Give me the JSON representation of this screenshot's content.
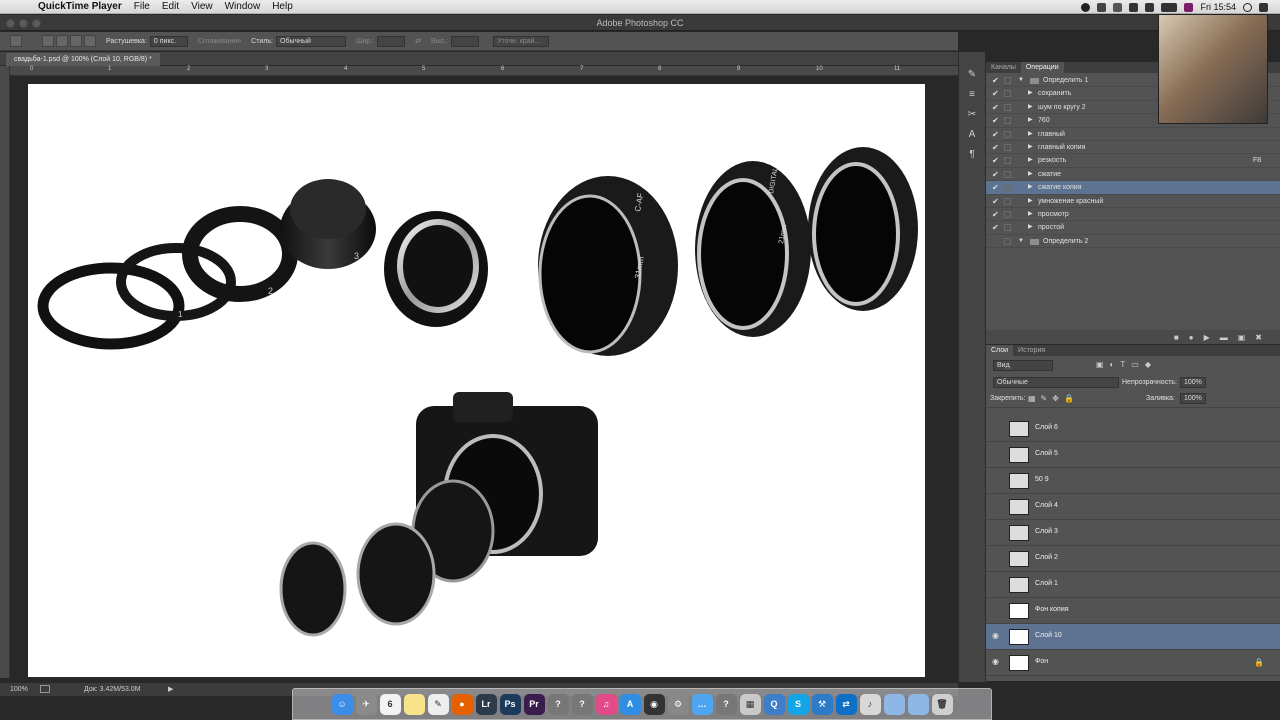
{
  "menubar": {
    "apple_glyph": "",
    "app_name": "QuickTime Player",
    "items": [
      "File",
      "Edit",
      "View",
      "Window",
      "Help"
    ],
    "clock": "Fri 15:54"
  },
  "window": {
    "title": "Adobe Photoshop CC"
  },
  "options_bar": {
    "feather_label": "Растушевка:",
    "feather_value": "0 пикс.",
    "antialias_label": "Сглаживание",
    "style_label": "Стиль:",
    "style_value": "Обычный",
    "width_label": "Шир.:",
    "height_label": "Выс.:",
    "refine_label": "Уточн. край..."
  },
  "document": {
    "tab_title": "свадьба-1.psd @ 100% (Слой 10, RGB/8) *",
    "ruler_marks": [
      "0",
      "1",
      "2",
      "3",
      "4",
      "5",
      "6",
      "7",
      "8",
      "9",
      "10",
      "11"
    ]
  },
  "actions_panel": {
    "tabs": [
      "Каналы",
      "Операции"
    ],
    "rows": [
      {
        "label": "Определить 1",
        "level": 0,
        "checked": true,
        "shortcut": ""
      },
      {
        "label": "сохранить",
        "level": 1,
        "checked": true,
        "shortcut": ""
      },
      {
        "label": "шум по кругу 2",
        "level": 1,
        "checked": true,
        "shortcut": ""
      },
      {
        "label": "760",
        "level": 1,
        "checked": true,
        "shortcut": ""
      },
      {
        "label": "главный",
        "level": 1,
        "checked": true,
        "shortcut": ""
      },
      {
        "label": "главный копия",
        "level": 1,
        "checked": true,
        "shortcut": ""
      },
      {
        "label": "резкость",
        "level": 1,
        "checked": true,
        "shortcut": "F8"
      },
      {
        "label": "сжатие",
        "level": 1,
        "checked": true,
        "shortcut": ""
      },
      {
        "label": "сжатие копия",
        "level": 1,
        "checked": true,
        "shortcut": "",
        "selected": true
      },
      {
        "label": "умножение красный",
        "level": 1,
        "checked": true,
        "shortcut": ""
      },
      {
        "label": "просмотр",
        "level": 1,
        "checked": true,
        "shortcut": ""
      },
      {
        "label": "простой",
        "level": 1,
        "checked": true,
        "shortcut": ""
      },
      {
        "label": "Определить 2",
        "level": 0,
        "checked": false,
        "shortcut": ""
      }
    ]
  },
  "layers_panel": {
    "tabs": [
      "Слои",
      "История"
    ],
    "filter_label": "Вид",
    "blend_mode": "Обычные",
    "opacity_label": "Непрозрачность:",
    "opacity_value": "100%",
    "lock_label": "Закрепить:",
    "fill_label": "Заливка:",
    "fill_value": "100%",
    "layers": [
      {
        "name": "Слой 6",
        "visible": false
      },
      {
        "name": "Слой 5",
        "visible": false
      },
      {
        "name": "50 9",
        "visible": false
      },
      {
        "name": "Слой 4",
        "visible": false
      },
      {
        "name": "Слой 3",
        "visible": false
      },
      {
        "name": "Слой 2",
        "visible": false
      },
      {
        "name": "Слой 1",
        "visible": false
      },
      {
        "name": "Фон копия",
        "visible": false
      },
      {
        "name": "Слой 10",
        "visible": true,
        "selected": true
      },
      {
        "name": "Фон",
        "visible": true,
        "locked": true
      }
    ]
  },
  "status_bar": {
    "zoom": "100%",
    "doc_info": "Док: 3.42M/53.0M"
  },
  "dock": {
    "calendar_day": "6",
    "icons": [
      {
        "name": "finder-icon",
        "color": "#3b8ee8",
        "glyph": "☺"
      },
      {
        "name": "launchpad-icon",
        "color": "#8a8a8a",
        "glyph": "✈"
      },
      {
        "name": "calendar-icon",
        "color": "#f2f2f2",
        "glyph": "6"
      },
      {
        "name": "notes-icon",
        "color": "#f7e38a",
        "glyph": ""
      },
      {
        "name": "textedit-icon",
        "color": "#eeeeee",
        "glyph": "✎"
      },
      {
        "name": "firefox-icon",
        "color": "#e66000",
        "glyph": "●"
      },
      {
        "name": "lightroom-icon",
        "color": "#2b3b4a",
        "glyph": "Lr"
      },
      {
        "name": "photoshop-icon",
        "color": "#1c3a5a",
        "glyph": "Ps"
      },
      {
        "name": "premiere-icon",
        "color": "#3a1d4d",
        "glyph": "Pr"
      },
      {
        "name": "unknown-app-icon",
        "color": "#777777",
        "glyph": "?"
      },
      {
        "name": "unknown-app-icon-2",
        "color": "#777777",
        "glyph": "?"
      },
      {
        "name": "itunes-icon",
        "color": "#e24a8a",
        "glyph": "♫"
      },
      {
        "name": "appstore-icon",
        "color": "#2f8de4",
        "glyph": "A"
      },
      {
        "name": "photobooth-icon",
        "color": "#333333",
        "glyph": "◉"
      },
      {
        "name": "system-prefs-icon",
        "color": "#888888",
        "glyph": "⚙"
      },
      {
        "name": "messages-icon",
        "color": "#4fa6f0",
        "glyph": "…"
      },
      {
        "name": "unknown-app-icon-3",
        "color": "#777777",
        "glyph": "?"
      },
      {
        "name": "preview-icon",
        "color": "#c9c9c9",
        "glyph": "▦"
      },
      {
        "name": "quicktime-icon",
        "color": "#3d7dc9",
        "glyph": "Q"
      },
      {
        "name": "skype-icon",
        "color": "#12a5e8",
        "glyph": "S"
      },
      {
        "name": "xcode-icon",
        "color": "#2d7ac8",
        "glyph": "⚒"
      },
      {
        "name": "teamviewer-icon",
        "color": "#0e6fc7",
        "glyph": "⇄"
      },
      {
        "name": "documents-icon",
        "color": "#d8d8d8",
        "glyph": "♪"
      },
      {
        "name": "folder-icon",
        "color": "#8fb7e6",
        "glyph": ""
      },
      {
        "name": "downloads-icon",
        "color": "#8fb7e6",
        "glyph": ""
      },
      {
        "name": "trash-icon",
        "color": "#cfcfcf",
        "glyph": "🗑"
      }
    ]
  },
  "canvas_labels": {
    "ring_1": "1",
    "ring_2": "2",
    "ring_3": "3",
    "tube_caf": "C-AF",
    "tube_31": "31mm",
    "tube_digital": "DIGITAL",
    "tube_21": "21mm"
  }
}
